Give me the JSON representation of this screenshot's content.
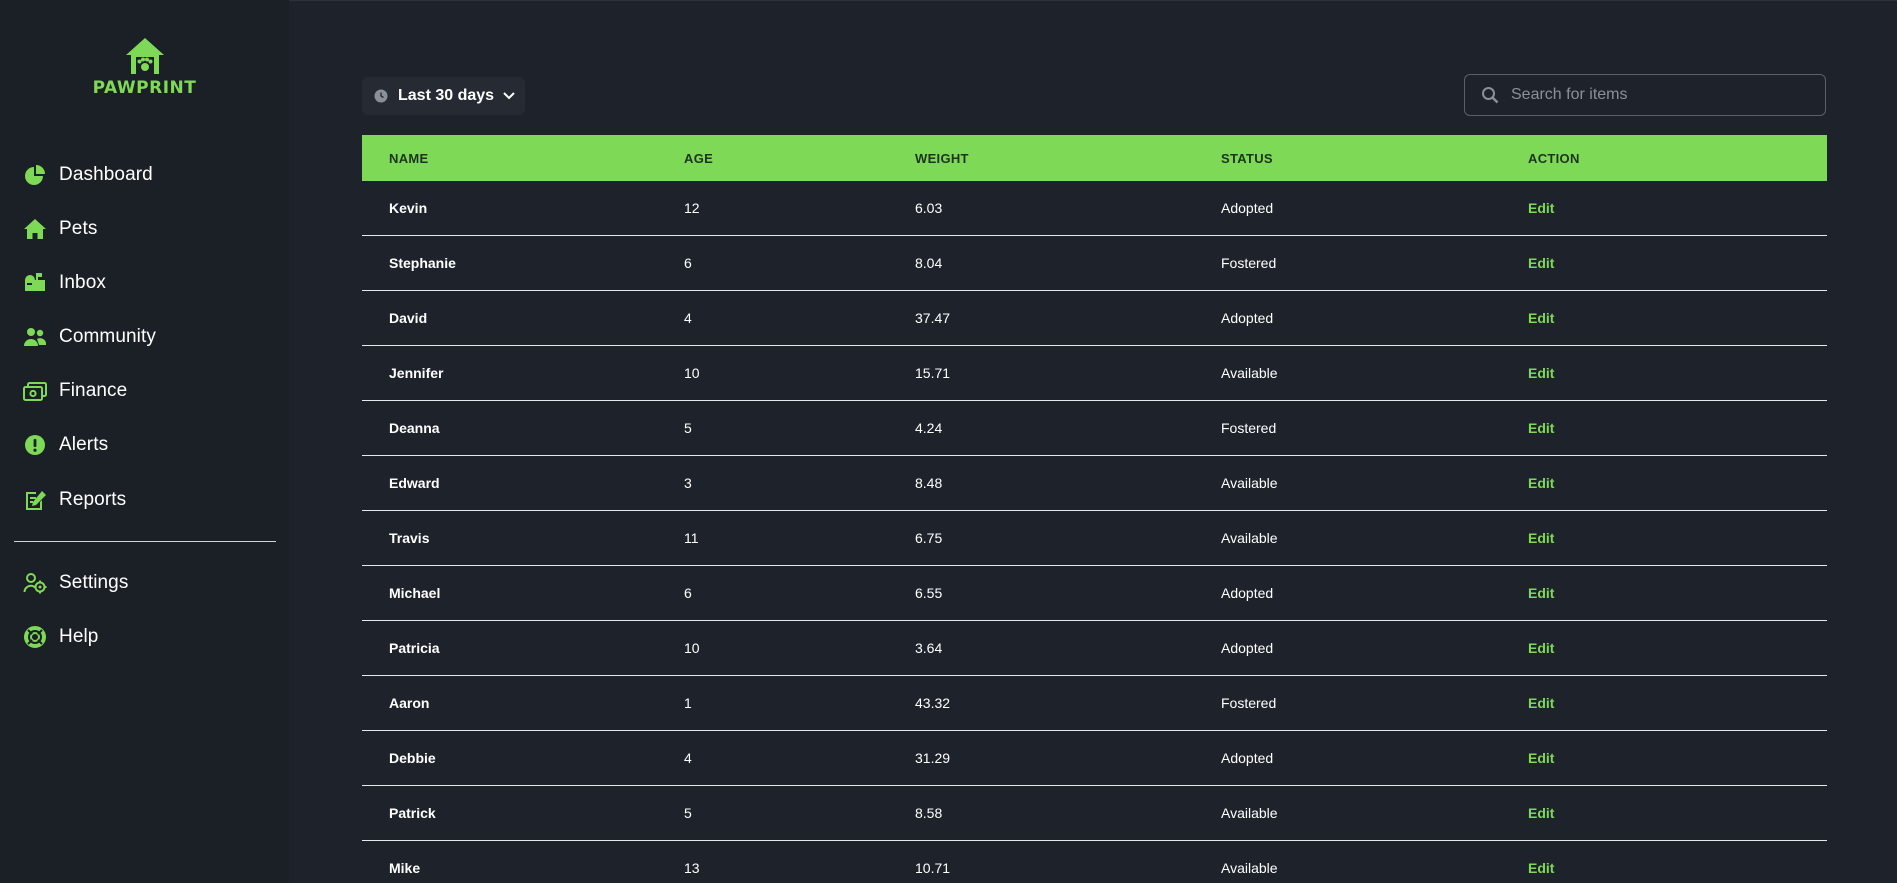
{
  "brand": {
    "name": "PAWPRINT",
    "accent": "#7ed957"
  },
  "sidebar": {
    "items": [
      {
        "label": "Dashboard",
        "icon": "pie-chart-icon"
      },
      {
        "label": "Pets",
        "icon": "home-icon"
      },
      {
        "label": "Inbox",
        "icon": "mailbox-icon"
      },
      {
        "label": "Community",
        "icon": "users-icon"
      },
      {
        "label": "Finance",
        "icon": "money-icon"
      },
      {
        "label": "Alerts",
        "icon": "alert-icon"
      },
      {
        "label": "Reports",
        "icon": "report-edit-icon"
      }
    ],
    "secondary": [
      {
        "label": "Settings",
        "icon": "user-gear-icon"
      },
      {
        "label": "Help",
        "icon": "lifebuoy-icon"
      }
    ]
  },
  "toolbar": {
    "range_label": "Last 30 days",
    "search_placeholder": "Search for items"
  },
  "table": {
    "columns": [
      "NAME",
      "AGE",
      "WEIGHT",
      "STATUS",
      "ACTION"
    ],
    "rows": [
      {
        "name": "Kevin",
        "age": "12",
        "weight": "6.03",
        "status": "Adopted",
        "action": "Edit"
      },
      {
        "name": "Stephanie",
        "age": "6",
        "weight": "8.04",
        "status": "Fostered",
        "action": "Edit"
      },
      {
        "name": "David",
        "age": "4",
        "weight": "37.47",
        "status": "Adopted",
        "action": "Edit"
      },
      {
        "name": "Jennifer",
        "age": "10",
        "weight": "15.71",
        "status": "Available",
        "action": "Edit"
      },
      {
        "name": "Deanna",
        "age": "5",
        "weight": "4.24",
        "status": "Fostered",
        "action": "Edit"
      },
      {
        "name": "Edward",
        "age": "3",
        "weight": "8.48",
        "status": "Available",
        "action": "Edit"
      },
      {
        "name": "Travis",
        "age": "11",
        "weight": "6.75",
        "status": "Available",
        "action": "Edit"
      },
      {
        "name": "Michael",
        "age": "6",
        "weight": "6.55",
        "status": "Adopted",
        "action": "Edit"
      },
      {
        "name": "Patricia",
        "age": "10",
        "weight": "3.64",
        "status": "Adopted",
        "action": "Edit"
      },
      {
        "name": "Aaron",
        "age": "1",
        "weight": "43.32",
        "status": "Fostered",
        "action": "Edit"
      },
      {
        "name": "Debbie",
        "age": "4",
        "weight": "31.29",
        "status": "Adopted",
        "action": "Edit"
      },
      {
        "name": "Patrick",
        "age": "5",
        "weight": "8.58",
        "status": "Available",
        "action": "Edit"
      },
      {
        "name": "Mike",
        "age": "13",
        "weight": "10.71",
        "status": "Available",
        "action": "Edit"
      }
    ]
  }
}
